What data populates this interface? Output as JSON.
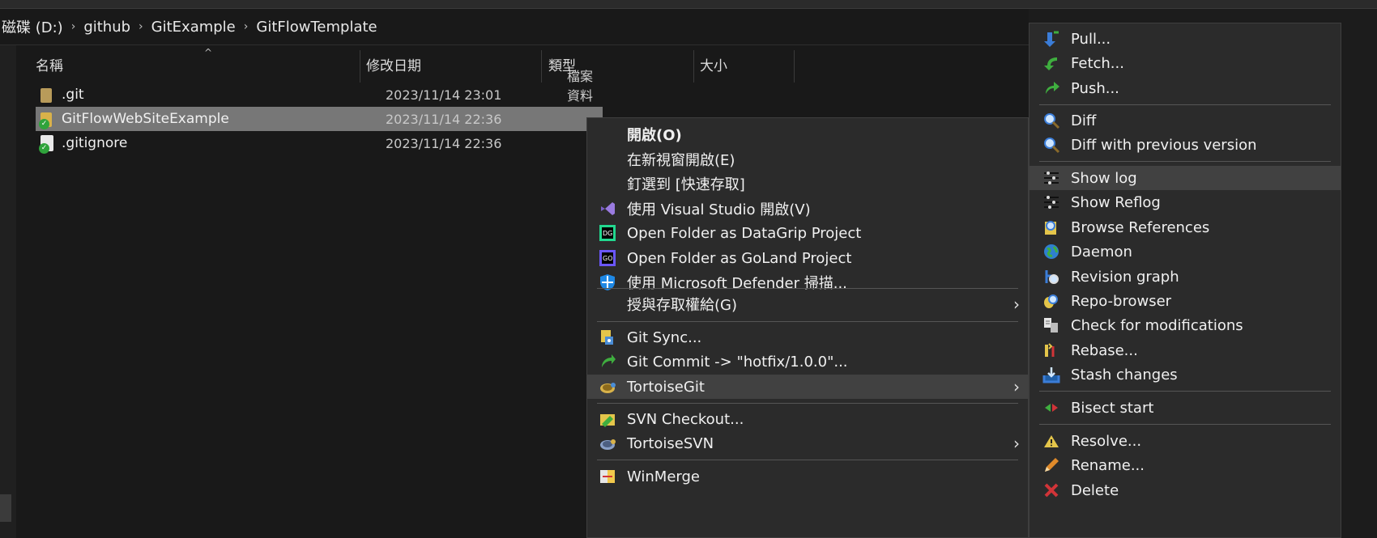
{
  "breadcrumb": [
    "磁碟 (D:)",
    "github",
    "GitExample",
    "GitFlowTemplate"
  ],
  "columns": {
    "name": "名稱",
    "date": "修改日期",
    "type": "類型",
    "size": "大小"
  },
  "files": [
    {
      "name": ".git",
      "date": "2023/11/14 23:01",
      "type": "檔案資料夾"
    },
    {
      "name": "GitFlowWebSiteExample",
      "date": "2023/11/14 22:36",
      "type": ""
    },
    {
      "name": ".gitignore",
      "date": "2023/11/14 22:36",
      "type": ""
    }
  ],
  "context_menu": {
    "items": [
      "開啟(O)",
      "在新視窗開啟(E)",
      "釘選到 [快速存取]",
      "使用 Visual Studio 開啟(V)",
      "Open Folder as DataGrip Project",
      "Open Folder as GoLand Project",
      "使用 Microsoft Defender 掃描...",
      "授與存取權給(G)",
      "Git Sync...",
      "Git Commit -> \"hotfix/1.0.0\"...",
      "TortoiseGit",
      "SVN Checkout...",
      "TortoiseSVN",
      "WinMerge"
    ],
    "icons": [
      "",
      "",
      "",
      "visual-studio-icon",
      "datagrip-icon",
      "goland-icon",
      "defender-shield-icon",
      "",
      "git-sync-icon",
      "git-commit-icon",
      "tortoisegit-icon",
      "svn-checkout-icon",
      "tortoisesvn-icon",
      "winmerge-icon"
    ]
  },
  "submenu": {
    "items": [
      "Pull...",
      "Fetch...",
      "Push...",
      "Diff",
      "Diff with previous version",
      "Show log",
      "Show Reflog",
      "Browse References",
      "Daemon",
      "Revision graph",
      "Repo-browser",
      "Check for modifications",
      "Rebase...",
      "Stash changes",
      "Bisect start",
      "Resolve...",
      "Rename...",
      "Delete"
    ]
  },
  "colors": {
    "accent_green": "#3fae3f",
    "highlight": "#414141",
    "selected_row": "#777777"
  }
}
